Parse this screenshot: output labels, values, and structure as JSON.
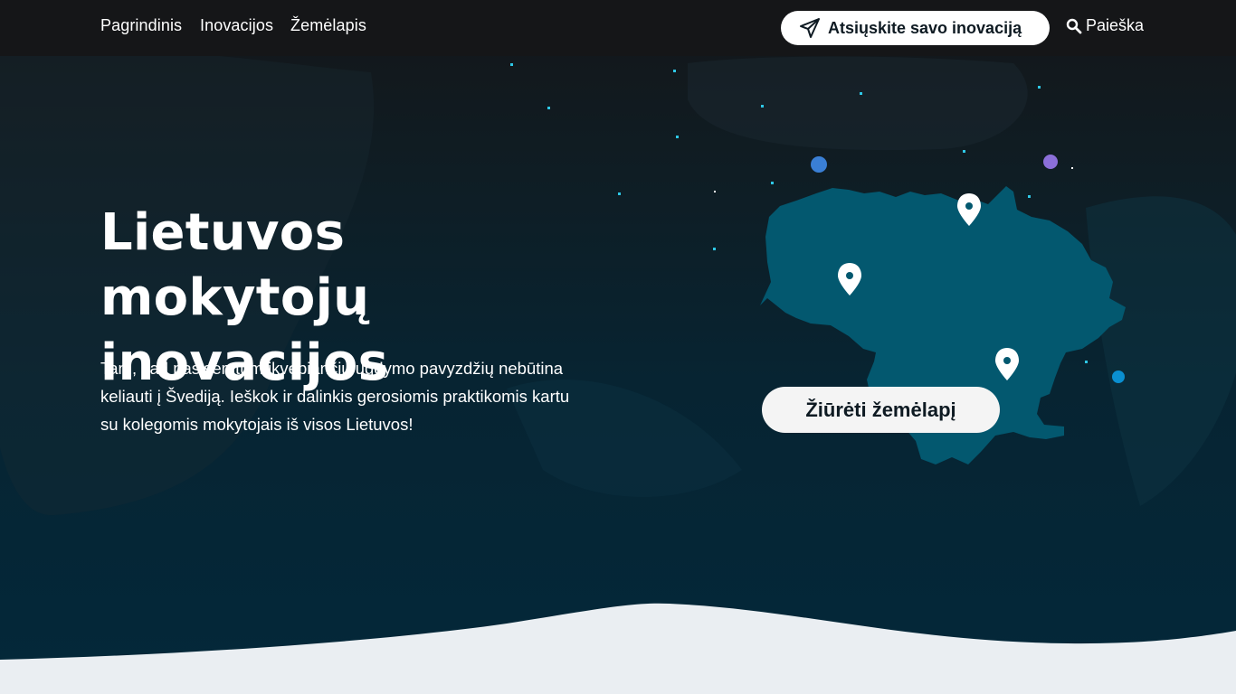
{
  "nav": {
    "links": [
      "Pagrindinis",
      "Inovacijos",
      "Žemėlapis"
    ],
    "submit_label": "Atsiųskite savo inovaciją",
    "search_label": "Paieška"
  },
  "hero": {
    "title": "Lietuvos mokytojų inovacijos",
    "description": "Tam, kad pasisemtum įkvepiančių ugdymo pavyzdžių nebūtina keliauti į Švediją. Ieškok ir dalinkis gerosiomis praktikomis kartu su kolegomis mokytojais iš visos Lietuvos!",
    "map_button_label": "Žiūrėti žemėlapį"
  },
  "icons": {
    "submit": "paper-plane-icon",
    "search": "search-icon",
    "map_pins": "map-pin-icon"
  },
  "colors": {
    "nav_bg": "#151618",
    "hero_top": "#141619",
    "hero_bottom": "#03283a",
    "map_fill": "#03586f",
    "page_bg": "#eaeef2",
    "button_bg": "#ffffff",
    "dot_cyan": "#2ec8e6",
    "dot_blue": "#3a7fd5",
    "dot_purple": "#8b6fd9"
  }
}
